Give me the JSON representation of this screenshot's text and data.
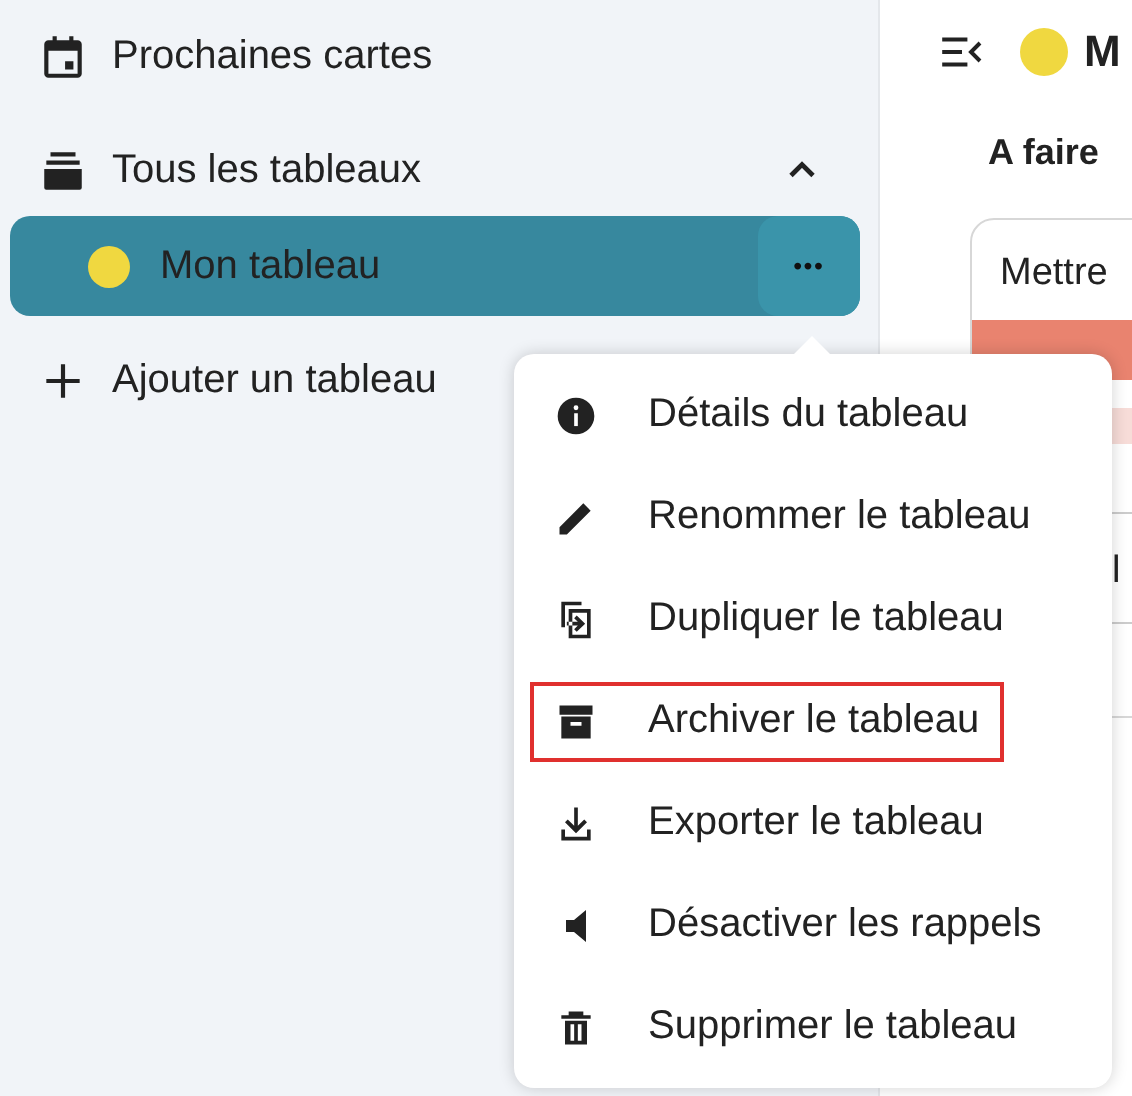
{
  "sidebar": {
    "items": [
      {
        "kind": "calendar",
        "label": "Prochaines cartes"
      },
      {
        "kind": "boards",
        "label": "Tous les tableaux",
        "expanded": true,
        "children": [
          {
            "label": "Mon tableau",
            "color": "#f0d840",
            "selected": true,
            "menu_button": "•••"
          }
        ]
      },
      {
        "kind": "add",
        "label": "Ajouter un tableau"
      }
    ]
  },
  "menu": {
    "items": [
      {
        "label": "Détails du tableau",
        "highlighted": false
      },
      {
        "label": "Renommer le tableau",
        "highlighted": false
      },
      {
        "label": "Dupliquer le tableau",
        "highlighted": false
      },
      {
        "label": "Archiver le tableau",
        "highlighted": true
      },
      {
        "label": "Exporter le tableau",
        "highlighted": false
      },
      {
        "label": "Désactiver les rappels",
        "highlighted": false
      },
      {
        "label": "Supprimer le tableau",
        "highlighted": false
      }
    ]
  },
  "main": {
    "board_title": "M",
    "column_title": "A faire",
    "card_title": "Mettre",
    "card_text_2": "l"
  }
}
